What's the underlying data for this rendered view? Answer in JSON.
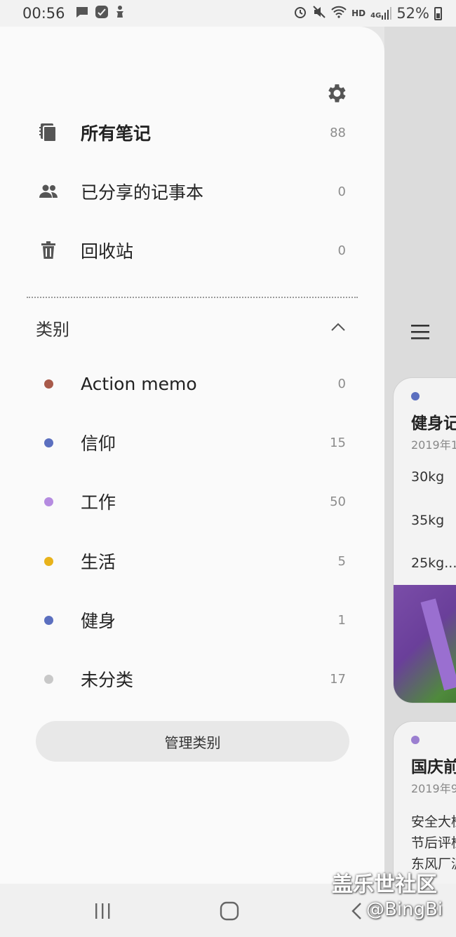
{
  "status_bar": {
    "time": "00:56",
    "network_label": "HD",
    "signal_label": "4G",
    "battery_percent": "52%"
  },
  "drawer": {
    "main_items": [
      {
        "label": "所有笔记",
        "count": "88",
        "icon": "notebook-icon",
        "bold": true
      },
      {
        "label": "已分享的记事本",
        "count": "0",
        "icon": "people-icon",
        "bold": false
      },
      {
        "label": "回收站",
        "count": "0",
        "icon": "trash-icon",
        "bold": false
      }
    ],
    "section_title": "类别",
    "categories": [
      {
        "label": "Action memo",
        "count": "0",
        "color": "#a85a4a"
      },
      {
        "label": "信仰",
        "count": "15",
        "color": "#5b6fbf"
      },
      {
        "label": "工作",
        "count": "50",
        "color": "#b58be0"
      },
      {
        "label": "生活",
        "count": "5",
        "color": "#e8b21a"
      },
      {
        "label": "健身",
        "count": "1",
        "color": "#5b6fbf"
      },
      {
        "label": "未分类",
        "count": "17",
        "color": "#c8c8c8"
      }
    ],
    "manage_button": "管理类别"
  },
  "background": {
    "card1": {
      "title": "健身记",
      "date": "2019年1",
      "lines": [
        "30kg",
        "35kg",
        "25kg..."
      ],
      "dot_color": "#5b6fbf"
    },
    "card2": {
      "title": "国庆前",
      "date": "2019年9",
      "lines": [
        "安全大检",
        "节后评检",
        "东风厂派"
      ],
      "dot_color": "#9b7fd0"
    }
  },
  "watermark": {
    "line1": "盖乐世社区",
    "line2": "@BingBi"
  }
}
